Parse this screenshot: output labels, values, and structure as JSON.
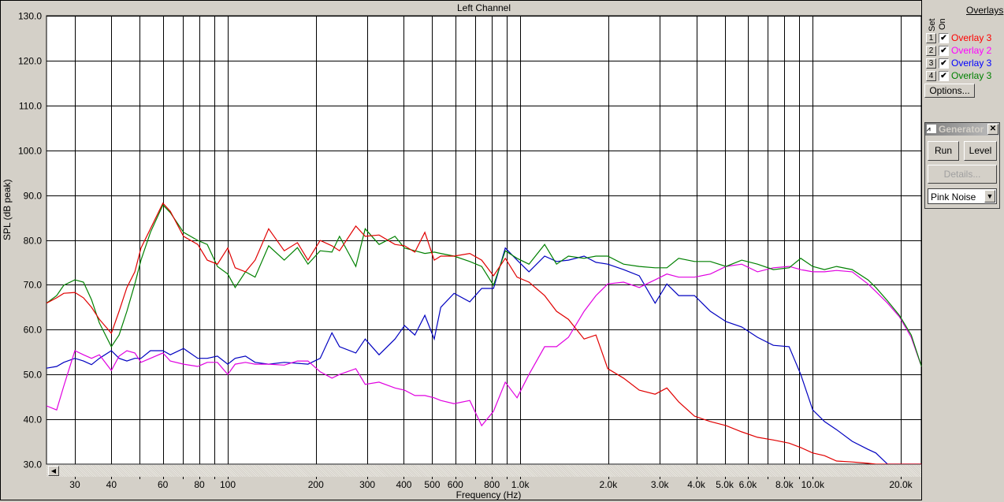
{
  "window": {
    "title": "Left Channel"
  },
  "axes": {
    "ylabel": "SPL (dB peak)",
    "xlabel": "Frequency (Hz)"
  },
  "overlays": {
    "heading": "Overlays",
    "set_label": "Set",
    "on_label": "On",
    "items": [
      {
        "set": "1",
        "checked": true,
        "label": "Overlay 3",
        "color": "#ff0000"
      },
      {
        "set": "2",
        "checked": true,
        "label": "Overlay 2",
        "color": "#ff00ff"
      },
      {
        "set": "3",
        "checked": true,
        "label": "Overlay 3",
        "color": "#0000ff"
      },
      {
        "set": "4",
        "checked": true,
        "label": "Overlay 3",
        "color": "#008000"
      }
    ],
    "options_label": "Options...",
    "check_glyph": "✔"
  },
  "generator": {
    "title": "Generator",
    "close": "✕",
    "run": "Run",
    "level": "Level",
    "details": "Details...",
    "signal": "Pink Noise",
    "arrow": "▼"
  },
  "scrollbar": {
    "left_arrow": "◀"
  },
  "chart_data": {
    "type": "line",
    "title": "Left Channel",
    "xlabel": "Frequency (Hz)",
    "ylabel": "SPL (dB peak)",
    "xscale": "log",
    "xlim": [
      24,
      23500
    ],
    "ylim": [
      30,
      130
    ],
    "grid": true,
    "yticks": [
      30,
      40,
      50,
      60,
      70,
      80,
      90,
      100,
      110,
      120,
      130
    ],
    "ytick_labels": [
      "30.0",
      "40.0",
      "50.0",
      "60.0",
      "70.0",
      "80.0",
      "90.0",
      "100.0",
      "110.0",
      "120.0",
      "130.0"
    ],
    "xgrid": [
      30,
      40,
      50,
      60,
      70,
      80,
      90,
      100,
      200,
      300,
      400,
      500,
      600,
      700,
      800,
      900,
      1000,
      2000,
      3000,
      4000,
      5000,
      6000,
      7000,
      8000,
      9000,
      10000,
      20000
    ],
    "xticks": [
      30,
      40,
      60,
      80,
      100,
      200,
      300,
      400,
      500,
      600,
      800,
      1000,
      2000,
      3000,
      4000,
      5000,
      6000,
      8000,
      10000,
      20000
    ],
    "xtick_labels": [
      "30",
      "40",
      "60",
      "80",
      "100",
      "200",
      "300",
      "400",
      "500",
      "600",
      "800",
      "1.0k",
      "2.0k",
      "3.0k",
      "4.0k",
      "5.0k",
      "6.0k",
      "8.0k",
      "10.0k",
      "20.0k"
    ],
    "x": [
      24,
      26,
      27.5,
      30,
      32.1,
      34.2,
      36.4,
      40,
      42.5,
      45.2,
      48.1,
      50.5,
      54.4,
      60,
      63.6,
      70.6,
      79,
      85.1,
      92.2,
      100,
      106,
      115,
      124,
      138,
      156,
      173,
      188,
      207,
      227,
      241,
      274,
      295,
      329,
      373,
      402,
      436,
      472,
      508,
      535,
      594,
      672,
      738,
      810,
      889,
      975,
      1071,
      1212,
      1331,
      1461,
      1653,
      1815,
      1992,
      2255,
      2553,
      2891,
      3171,
      3482,
      3944,
      4466,
      5053,
      5719,
      6475,
      7333,
      8301,
      9103,
      10000,
      10970,
      12060,
      13650,
      15450,
      16440,
      18030,
      19780,
      21720,
      23540
    ],
    "series": [
      {
        "name": "Overlay 3 (set 3)",
        "color": "#0000c0",
        "values": [
          51.4,
          51.8,
          52.7,
          53.6,
          53,
          52.2,
          53.6,
          55.3,
          53.6,
          53,
          53.6,
          53.6,
          55.3,
          55.3,
          54.4,
          55.8,
          53.6,
          53.6,
          54.1,
          52.3,
          53.6,
          54.1,
          52.7,
          52.3,
          52.7,
          52.5,
          52.3,
          53.6,
          59.3,
          56.2,
          54.8,
          57.9,
          54.4,
          57.9,
          60.9,
          58.8,
          63.2,
          57.9,
          65,
          68.1,
          66.2,
          69.2,
          69.2,
          78.2,
          75.5,
          72.9,
          76.4,
          75.2,
          75.5,
          76.4,
          75,
          74.6,
          73.4,
          72,
          65.9,
          70.2,
          67.6,
          67.6,
          64.1,
          61.8,
          60.6,
          58.3,
          56.5,
          56.2,
          50,
          42.1,
          39.5,
          37.7,
          35.1,
          33.3,
          32.5,
          30,
          30,
          30,
          30
        ]
      },
      {
        "name": "Overlay 2 (set 2)",
        "color": "#e000e0",
        "values": [
          43,
          42.1,
          47.4,
          55.3,
          54.4,
          53.6,
          54.4,
          50.9,
          54.1,
          55.3,
          54.8,
          52.7,
          53.6,
          54.8,
          53,
          52.3,
          51.8,
          52.7,
          52.7,
          50,
          52.3,
          52.7,
          52.3,
          52.3,
          52.1,
          53,
          53,
          50.6,
          49.2,
          50,
          51.3,
          47.8,
          48.3,
          47,
          46.5,
          45.3,
          45.3,
          44.8,
          44.2,
          43.5,
          44.2,
          38.6,
          41.8,
          48.3,
          44.8,
          50,
          56.2,
          56.2,
          58.3,
          64.1,
          67.6,
          70.2,
          70.6,
          69.4,
          71.1,
          72.4,
          71.7,
          71.7,
          72.4,
          74.1,
          74.6,
          72.9,
          73.8,
          74.1,
          73.4,
          72.9,
          72.9,
          73.2,
          72.9,
          70.2,
          68.5,
          65.9,
          62.9,
          58.3,
          51.8
        ]
      },
      {
        "name": "Overlay 3 (set 4)",
        "color": "#008000",
        "values": [
          65.9,
          67.6,
          69.9,
          71.1,
          70.6,
          66.7,
          61.5,
          56.2,
          58.8,
          64.1,
          70.2,
          75.5,
          81.7,
          87.8,
          86.1,
          81.7,
          79.9,
          79,
          74.1,
          72.4,
          69.4,
          72.9,
          71.7,
          78.7,
          75.5,
          78.3,
          74.6,
          77.6,
          77.3,
          80.8,
          74.1,
          82.5,
          79,
          80.8,
          78.2,
          77.6,
          77,
          77.3,
          77,
          76.4,
          75.2,
          74.1,
          69.9,
          77.6,
          75.9,
          74.6,
          79,
          74.6,
          76.4,
          75.9,
          76.4,
          76.4,
          74.6,
          74.1,
          73.8,
          73.8,
          75.9,
          75.2,
          75.2,
          74.1,
          75.5,
          74.6,
          73.4,
          73.8,
          75.9,
          74.1,
          73.4,
          74.1,
          73.4,
          71.1,
          69.4,
          66.4,
          63.2,
          58.8,
          51.8
        ]
      },
      {
        "name": "Overlay 3 (set 1)",
        "color": "#e00000",
        "values": [
          65.9,
          67.1,
          68.1,
          68.3,
          67.1,
          65,
          62.3,
          59.2,
          64.1,
          69.4,
          72.9,
          78.2,
          82.5,
          88.2,
          86.4,
          80.8,
          79,
          75.5,
          74.6,
          78.2,
          73.8,
          72.9,
          75.5,
          82.5,
          77.6,
          79.4,
          75.5,
          79.9,
          78.7,
          77.6,
          83.1,
          80.8,
          81.1,
          79,
          78.7,
          77.3,
          81.7,
          75.5,
          76.4,
          76.4,
          77,
          75.5,
          72,
          75.9,
          71.7,
          70.6,
          67.6,
          64.1,
          62.3,
          57.9,
          58.8,
          51.3,
          49.2,
          46.5,
          45.6,
          47,
          43.9,
          40.7,
          39.5,
          38.6,
          37.2,
          36,
          35.4,
          34.7,
          33.7,
          32.5,
          31.9,
          30.7,
          30.5,
          30.2,
          30,
          30,
          30,
          30,
          30
        ]
      }
    ]
  }
}
